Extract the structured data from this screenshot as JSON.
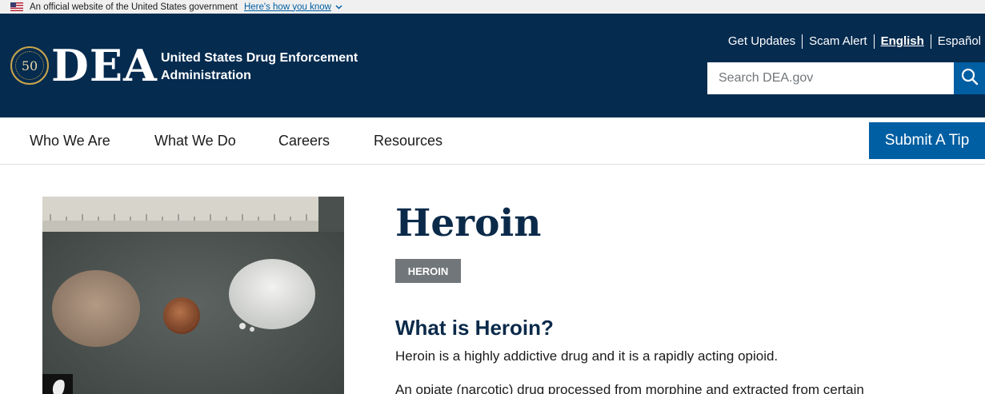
{
  "gov_banner": {
    "text": "An official website of the United States government",
    "link": "Here's how you know"
  },
  "header": {
    "logo_text": "DEA",
    "seal_text": "50",
    "agency_line1": "United States Drug Enforcement",
    "agency_line2": "Administration",
    "util_links": [
      "Get Updates",
      "Scam Alert",
      "English",
      "Español"
    ],
    "search_placeholder": "Search DEA.gov"
  },
  "nav": {
    "items": [
      "Who We Are",
      "What We Do",
      "Careers",
      "Resources"
    ],
    "tip_button": "Submit A Tip"
  },
  "content": {
    "title": "Heroin",
    "tag": "HEROIN",
    "subheading": "What is Heroin?",
    "paragraph1": "Heroin is a highly addictive drug and it is a rapidly acting opioid.",
    "paragraph2": "An opiate (narcotic) drug processed from morphine and extracted from certain"
  },
  "colors": {
    "header_bg": "#052b4f",
    "primary_blue": "#005ea2",
    "heading_navy": "#0b2a4a",
    "tag_gray": "#71767a"
  }
}
